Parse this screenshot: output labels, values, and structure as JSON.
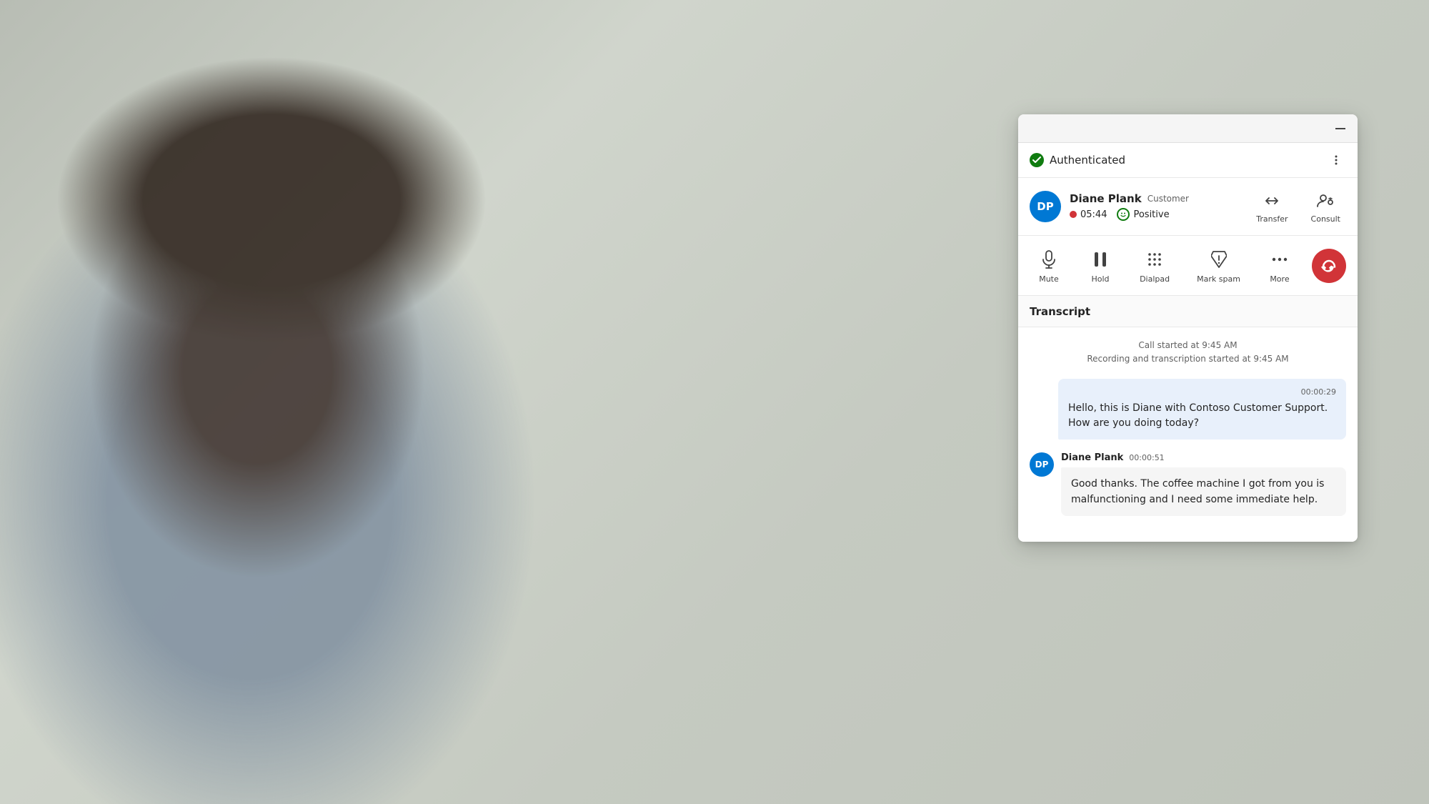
{
  "background": {
    "color": "#c8cdc4"
  },
  "panel": {
    "top_bar": {
      "minimize_label": "—"
    },
    "auth_bar": {
      "status": "Authenticated",
      "more_icon": "⋮"
    },
    "caller": {
      "avatar_initials": "DP",
      "name": "Diane Plank",
      "type": "Customer",
      "timer": "05:44",
      "sentiment": "Positive",
      "transfer_label": "Transfer",
      "consult_label": "Consult"
    },
    "controls": {
      "mute_label": "Mute",
      "hold_label": "Hold",
      "dialpad_label": "Dialpad",
      "mark_spam_label": "Mark spam",
      "more_label": "More",
      "end_call_icon": "📞"
    },
    "transcript": {
      "title": "Transcript",
      "call_started": "Call started at 9:45 AM",
      "recording_started": "Recording and transcription started at 9:45 AM",
      "messages": [
        {
          "type": "agent",
          "timestamp": "00:00:29",
          "text": "Hello, this is Diane with Contoso Customer Support. How are you doing today?"
        },
        {
          "type": "customer",
          "avatar": "DP",
          "sender": "Diane Plank",
          "timestamp": "00:00:51",
          "text": "Good thanks. The coffee machine I got from you is malfunctioning and I need some immediate help."
        }
      ]
    }
  }
}
